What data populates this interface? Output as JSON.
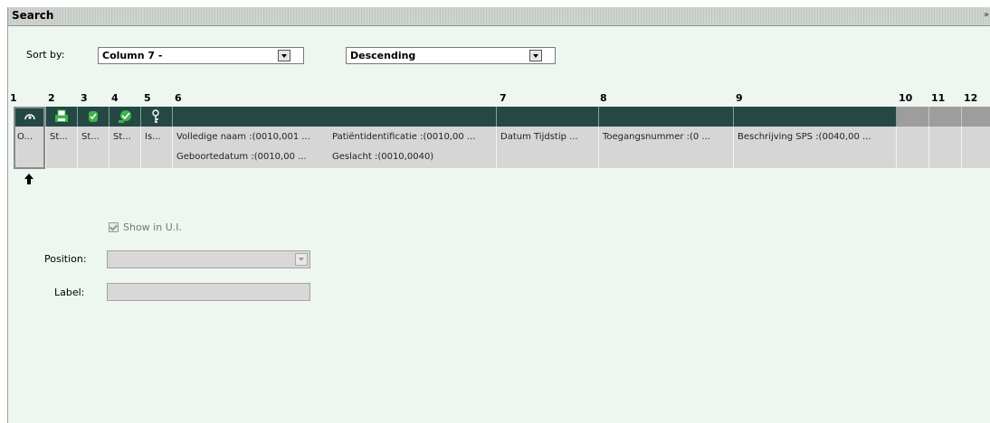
{
  "panel": {
    "title": "Search",
    "collapse_glyph": "»"
  },
  "sort": {
    "label": "Sort by:",
    "column_value": "Column 7 -",
    "order_value": "Descending"
  },
  "columns": {
    "numbers": [
      "1",
      "2",
      "3",
      "4",
      "5",
      "6",
      "7",
      "8",
      "9",
      "10",
      "11",
      "12"
    ],
    "icons": [
      "eye-icon",
      "printer-icon",
      "database-icon",
      "user-check-icon",
      "key-icon"
    ],
    "row1": [
      "O...",
      "St...",
      "St...",
      "St...",
      "Is...",
      "Volledige naam :(0010,001 ...",
      "Patiëntidentificatie :(0010,00 ...",
      "Datum Tijdstip ...",
      "Toegangsnummer :(0 ...",
      "Beschrijving SPS :(0040,00 ..."
    ],
    "row2": [
      "Geboortedatum :(0010,00 ...",
      "Geslacht :(0010,0040)"
    ]
  },
  "selection_marker": "🡅",
  "form": {
    "show_in_ui_label": "Show in U.I.",
    "show_in_ui_checked": true,
    "position_label": "Position:",
    "position_value": "",
    "label_label": "Label:",
    "label_value": ""
  },
  "colors": {
    "header_dark": "#254844",
    "panel_bg": "#eef6f0",
    "accent_green": "#2fae3a"
  }
}
